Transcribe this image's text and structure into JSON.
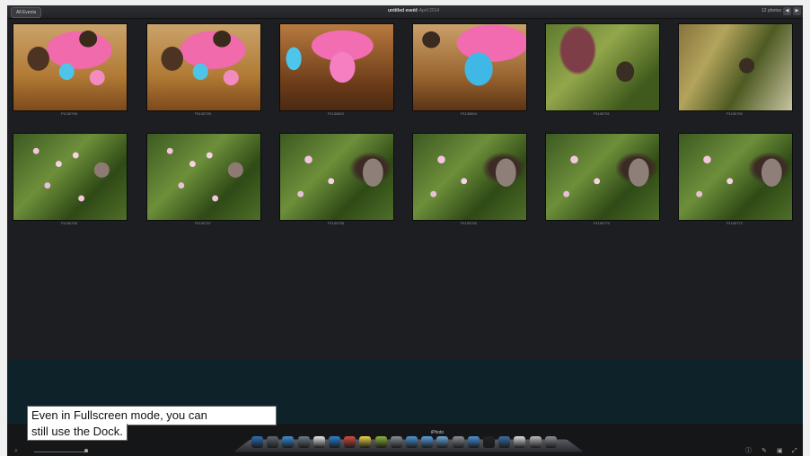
{
  "toolbar": {
    "back_label": "All Events",
    "event_title": "untitled event",
    "event_date": "15 April 2014",
    "photo_count": "12 photos",
    "prev_icon": "triangle-left",
    "next_icon": "triangle-right"
  },
  "photos": [
    {
      "caption": "P1130796"
    },
    {
      "caption": "P1130795"
    },
    {
      "caption": "P1130802"
    },
    {
      "caption": "P1130804"
    },
    {
      "caption": "P1150751"
    },
    {
      "caption": "P1150750"
    },
    {
      "caption": "P1150756"
    },
    {
      "caption": "P1150757"
    },
    {
      "caption": "P1150758"
    },
    {
      "caption": "P1150760"
    },
    {
      "caption": "P1150770"
    },
    {
      "caption": "P1150772"
    }
  ],
  "dock": {
    "label": "iPhoto",
    "icon_colors": [
      "#2f6fb7",
      "#5d6770",
      "#3b8fd8",
      "#6c7a8a",
      "#e8eaec",
      "#2d82d3",
      "#d24b3e",
      "#f1d34a",
      "#8fb33e",
      "#8a8f98",
      "#4d95d8",
      "#5aa0e0",
      "#6aa7d8",
      "#8c8f95",
      "#4b93d8",
      "#222",
      "#3a6fa8",
      "#ddd",
      "#bdbdbd",
      "#8a8d92"
    ]
  },
  "status_bar": {
    "zoom_icon": "magnifier",
    "info_icon": "info-icon",
    "edit_icon": "pencil-icon",
    "share_icon": "share-icon",
    "fullscreen_icon": "exit-fullscreen-icon"
  },
  "callout": {
    "line1": "Even in Fullscreen mode, you can",
    "line2": "still use the Dock."
  }
}
